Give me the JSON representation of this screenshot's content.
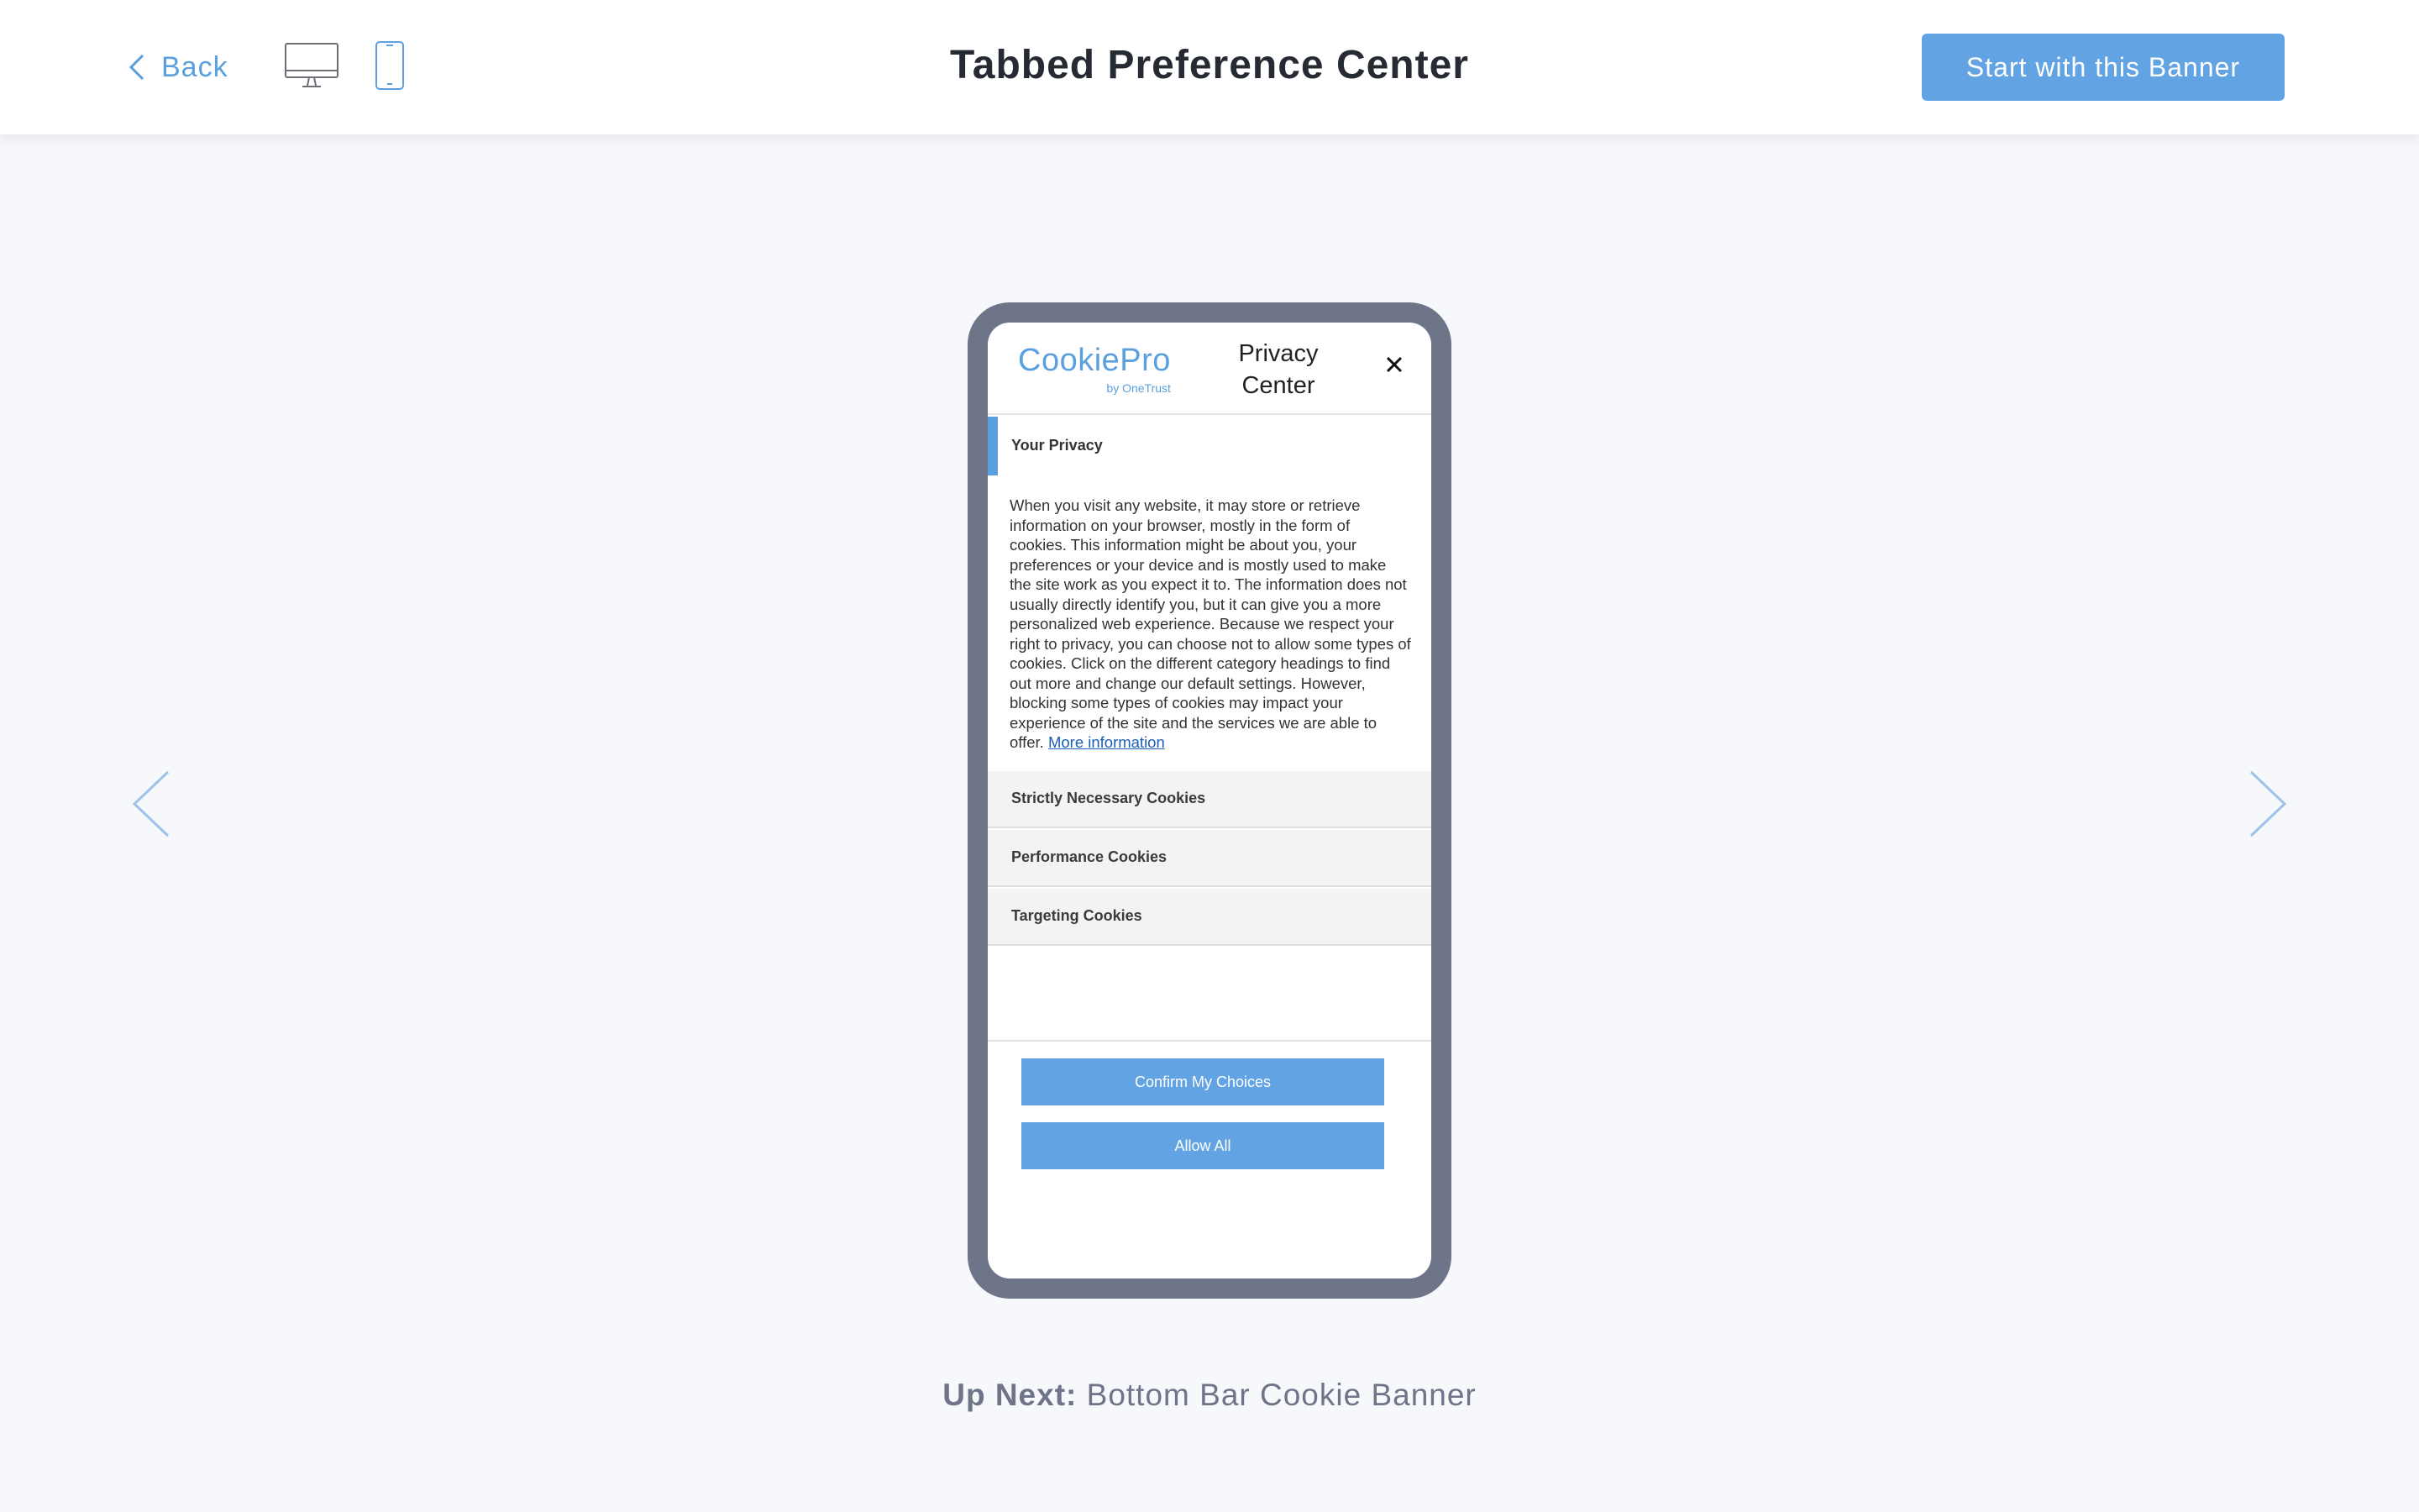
{
  "header": {
    "back_label": "Back",
    "page_title": "Tabbed Preference Center",
    "cta_label": "Start with this Banner",
    "devices": [
      "desktop-icon",
      "mobile-icon"
    ],
    "selected_device": "mobile"
  },
  "preview": {
    "brand": {
      "logo_main": "CookiePro",
      "logo_sub": "by OneTrust"
    },
    "title": "Privacy Center",
    "active_tab": "Your Privacy",
    "description": "When you visit any website, it may store or retrieve information on your browser, mostly in the form of cookies. This information might be about you, your preferences or your device and is mostly used to make the site work as you expect it to. The information does not usually directly identify you, but it can give you a more personalized web experience. Because we respect your right to privacy, you can choose not to allow some types of cookies. Click on the different category headings to find out more and change our default settings. However, blocking some types of cookies may impact your experience of the site and the services we are able to offer.",
    "more_info_link": "More information",
    "categories": [
      "Strictly Necessary Cookies",
      "Performance Cookies",
      "Targeting Cookies"
    ],
    "buttons": {
      "confirm": "Confirm My Choices",
      "allow_all": "Allow All"
    }
  },
  "footer": {
    "up_next_label": "Up Next:",
    "up_next_title": "Bottom Bar Cookie Banner"
  },
  "colors": {
    "accent": "#62a4e3",
    "link": "#1b5fb5",
    "phone_frame": "#6e7589",
    "background": "#f7f8fb"
  }
}
